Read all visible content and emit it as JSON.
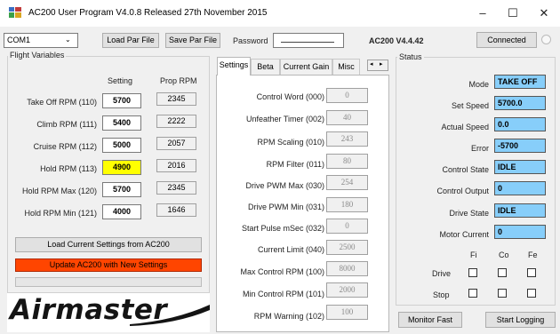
{
  "window": {
    "title": "AC200 User Program V4.0.8 Released 27th November 2015",
    "minimize": "–",
    "maximize": "☐",
    "close": "✕"
  },
  "toolbar": {
    "com_port": "COM1",
    "load_par_label": "Load Par File",
    "save_par_label": "Save Par File",
    "password_label": "Password",
    "password_value": "",
    "version": "AC200 V4.4.42",
    "connected_label": "Connected"
  },
  "flight": {
    "group_title": "Flight Variables",
    "setting_header": "Setting",
    "prop_header": "Prop RPM",
    "rows": [
      {
        "label": "Take Off RPM (110)",
        "setting": "5700",
        "prop": "2345"
      },
      {
        "label": "Climb RPM (111)",
        "setting": "5400",
        "prop": "2222"
      },
      {
        "label": "Cruise RPM (112)",
        "setting": "5000",
        "prop": "2057"
      },
      {
        "label": "Hold RPM (113)",
        "setting": "4900",
        "prop": "2016"
      },
      {
        "label": "Hold RPM Max (120)",
        "setting": "5700",
        "prop": "2345"
      },
      {
        "label": "Hold RPM Min (121)",
        "setting": "4000",
        "prop": "1646"
      }
    ],
    "load_button": "Load Current Settings from AC200",
    "update_button": "Update AC200 with New Settings",
    "logo": "Airmaster"
  },
  "settings": {
    "tabs": [
      "Settings",
      "Beta",
      "Current Gain",
      "Misc"
    ],
    "rows": [
      {
        "label": "Control Word (000)",
        "value": "0"
      },
      {
        "label": "Unfeather Timer (002)",
        "value": "40"
      },
      {
        "label": "RPM Scaling (010)",
        "value": "243"
      },
      {
        "label": "RPM Filter (011)",
        "value": "80"
      },
      {
        "label": "Drive PWM Max (030)",
        "value": "254"
      },
      {
        "label": "Drive PWM Min (031)",
        "value": "180"
      },
      {
        "label": "Start Pulse mSec (032)",
        "value": "0"
      },
      {
        "label": "Current Limit (040)",
        "value": "2500"
      },
      {
        "label": "Max Control RPM (100)",
        "value": "8000"
      },
      {
        "label": "Min Control RPM (101)",
        "value": "2000"
      },
      {
        "label": "RPM Warning (102)",
        "value": "100"
      }
    ]
  },
  "status": {
    "group_title": "Status",
    "rows": [
      {
        "label": "Mode",
        "value": "TAKE OFF"
      },
      {
        "label": "Set Speed",
        "value": "5700.0"
      },
      {
        "label": "Actual Speed",
        "value": "0.0"
      },
      {
        "label": "Error",
        "value": "-5700"
      },
      {
        "label": "Control State",
        "value": "IDLE"
      },
      {
        "label": "Control Output",
        "value": "0"
      },
      {
        "label": "Drive State",
        "value": "IDLE"
      },
      {
        "label": "Motor Current",
        "value": "0"
      }
    ],
    "col_headers": [
      "Fi",
      "Co",
      "Fe"
    ],
    "drive_label": "Drive",
    "stop_label": "Stop",
    "monitor_button": "Monitor Fast",
    "logging_button": "Start Logging"
  },
  "colors": {
    "highlight": "#ffff00",
    "update_button": "#ff4500",
    "status_field": "#87cefa"
  }
}
